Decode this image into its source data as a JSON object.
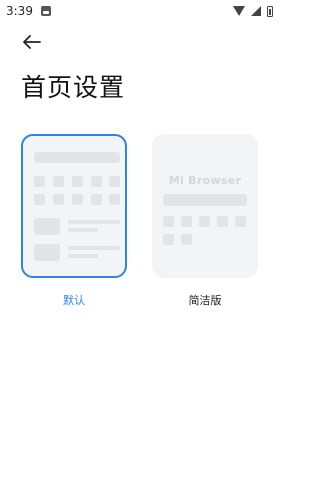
{
  "status_bar": {
    "time": "3:39",
    "icons": [
      "image-icon",
      "wifi-icon",
      "signal-icon",
      "battery-icon"
    ]
  },
  "header": {
    "back_icon": "arrow-left-icon",
    "title": "首页设置"
  },
  "options": [
    {
      "label": "默认",
      "selected": true
    },
    {
      "label": "简洁版",
      "selected": false,
      "brand_text": "Mi Browser"
    }
  ],
  "colors": {
    "accent": "#2b84e6",
    "card_bg": "#f3f4f6",
    "placeholder": "#e2e4e8"
  }
}
